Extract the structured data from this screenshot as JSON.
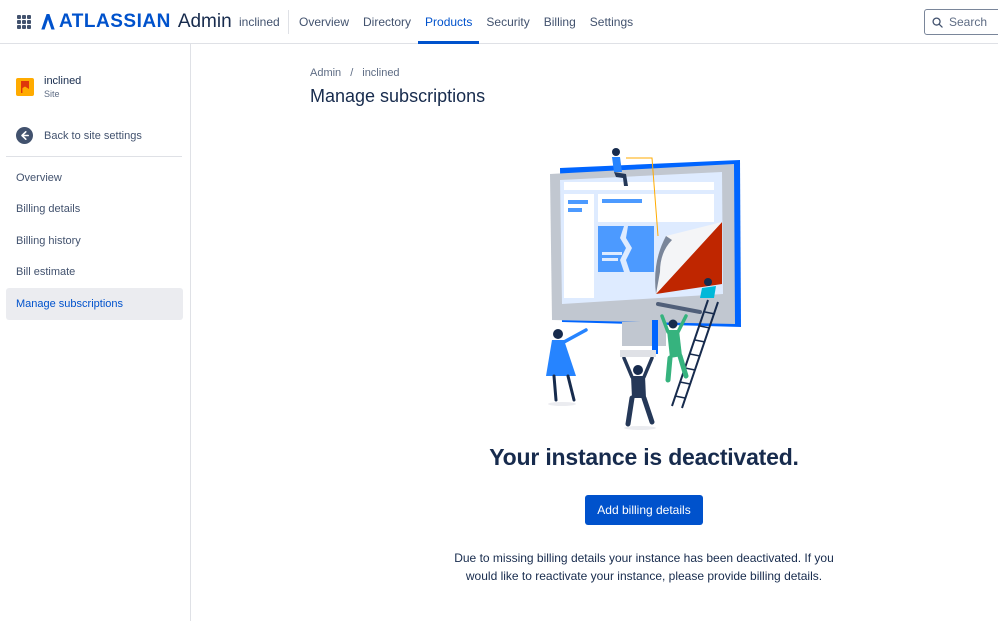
{
  "header": {
    "logo_text": "ATLASSIAN",
    "logo_suffix": "Admin",
    "site_name": "inclined",
    "nav": [
      {
        "label": "Overview",
        "active": false
      },
      {
        "label": "Directory",
        "active": false
      },
      {
        "label": "Products",
        "active": true
      },
      {
        "label": "Security",
        "active": false
      },
      {
        "label": "Billing",
        "active": false
      },
      {
        "label": "Settings",
        "active": false
      }
    ],
    "search_label": "Search"
  },
  "sidebar": {
    "site_title": "inclined",
    "site_subtitle": "Site",
    "back_label": "Back to site settings",
    "items": [
      {
        "label": "Overview",
        "active": false
      },
      {
        "label": "Billing details",
        "active": false
      },
      {
        "label": "Billing history",
        "active": false
      },
      {
        "label": "Bill estimate",
        "active": false
      },
      {
        "label": "Manage subscriptions",
        "active": true
      }
    ]
  },
  "main": {
    "breadcrumb": [
      "Admin",
      "inclined"
    ],
    "breadcrumb_separator": "/",
    "title": "Manage subscriptions",
    "headline": "Your instance is deactivated.",
    "cta_label": "Add billing details",
    "description": "Due to missing billing details your instance has been deactivated. If you would like to reactivate your instance, please provide billing details."
  },
  "colors": {
    "brand": "#0052cc",
    "text": "#172b4d",
    "subtle_text": "#42526e",
    "active_bg": "#ebecf0"
  }
}
